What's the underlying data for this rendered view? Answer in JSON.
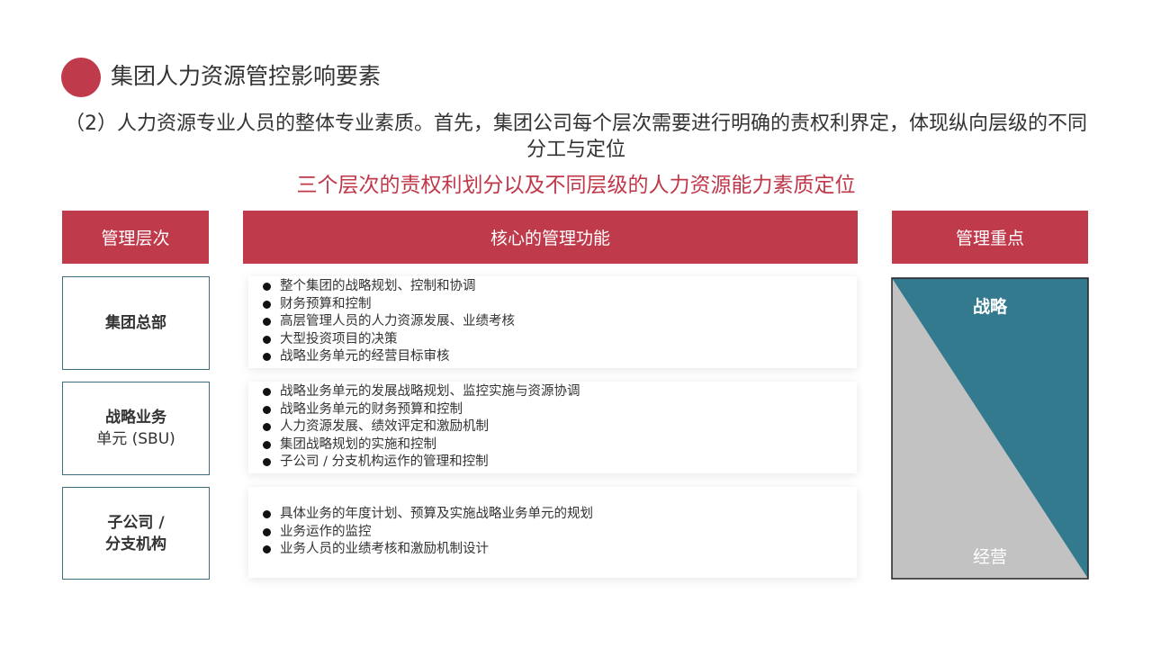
{
  "title": "集团人力资源管控影响要素",
  "intro": "（2）人力资源专业人员的整体专业素质。首先，集团公司每个层次需要进行明确的责权利界定，体现纵向层级的不同分工与定位",
  "subtitle": "三个层次的责权利划分以及不同层级的人力资源能力素质定位",
  "headers": {
    "level": "管理层次",
    "functions": "核心的管理功能",
    "focus": "管理重点"
  },
  "rows": [
    {
      "level_lines": [
        "集团总部"
      ],
      "items": [
        "整个集团的战略规划、控制和协调",
        "财务预算和控制",
        "高层管理人员的人力资源发展、业绩考核",
        "大型投资项目的决策",
        "战略业务单元的经营目标审核"
      ]
    },
    {
      "level_lines": [
        "战略业务",
        "单元 (SBU)"
      ],
      "items": [
        "战略业务单元的发展战略规划、监控实施与资源协调",
        "战略业务单元的财务预算和控制",
        "人力资源发展、绩效评定和激励机制",
        "集团战略规划的实施和控制",
        "子公司 / 分支机构运作的管理和控制"
      ]
    },
    {
      "level_lines": [
        "子公司 /",
        "分支机构"
      ],
      "items": [
        "具体业务的年度计划、预算及实施战略业务单元的规划",
        "业务运作的监控",
        "业务人员的业绩考核和激励机制设计"
      ]
    }
  ],
  "focus": {
    "top_label": "战略",
    "bottom_label": "经营"
  },
  "colors": {
    "accent": "#bf3a4b",
    "strategy": "#337a8f",
    "operation": "#c2c2c2",
    "border": "#3d6f80"
  }
}
